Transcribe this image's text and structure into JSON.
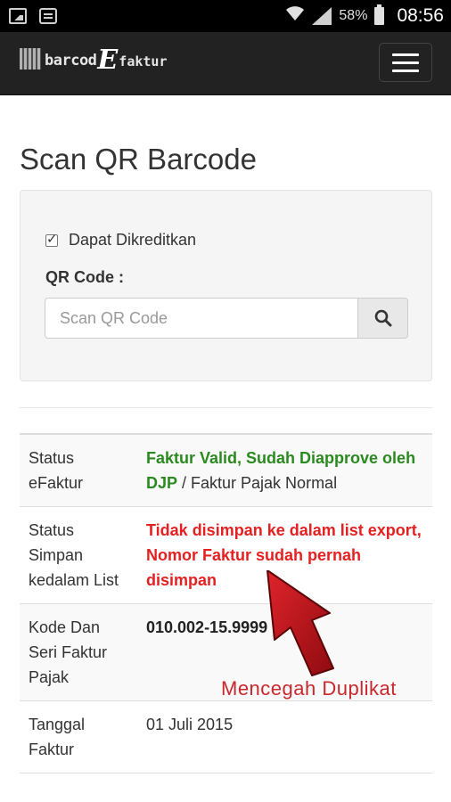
{
  "statusbar": {
    "battery": "58%",
    "time": "08:56",
    "icons": [
      "gallery-icon",
      "chat-icon",
      "wifi-icon",
      "signal-icon",
      "battery-icon"
    ]
  },
  "navbar": {
    "brand_part1": "barcod",
    "brand_e": "E",
    "brand_part2": "faktur"
  },
  "page_title": "Scan QR Barcode",
  "form": {
    "checkbox_label": "Dapat Dikreditkan",
    "checkbox_checked": true,
    "qr_label": "QR Code :",
    "qr_placeholder": "Scan QR Code"
  },
  "table": {
    "rows": [
      {
        "label": "Status eFaktur",
        "value_main": "Faktur Valid, Sudah Diapprove oleh DJP",
        "value_suffix": " / Faktur Pajak Normal"
      },
      {
        "label": "Status Simpan kedalam List",
        "value_main": "Tidak disimpan ke dalam list export, Nomor Faktur sudah pernah disimpan"
      },
      {
        "label": "Kode Dan Seri Faktur Pajak",
        "value_main": "010.002-15.9999"
      },
      {
        "label": "Tanggal Faktur",
        "value_main": "01 Juli 2015"
      }
    ]
  },
  "annotation": {
    "text": "Mencegah Duplikat",
    "arrow_color": "#c0141c"
  },
  "colors": {
    "navbar_bg": "#222222",
    "valid_green": "#2a8a1f",
    "warning_red": "#e52020"
  }
}
